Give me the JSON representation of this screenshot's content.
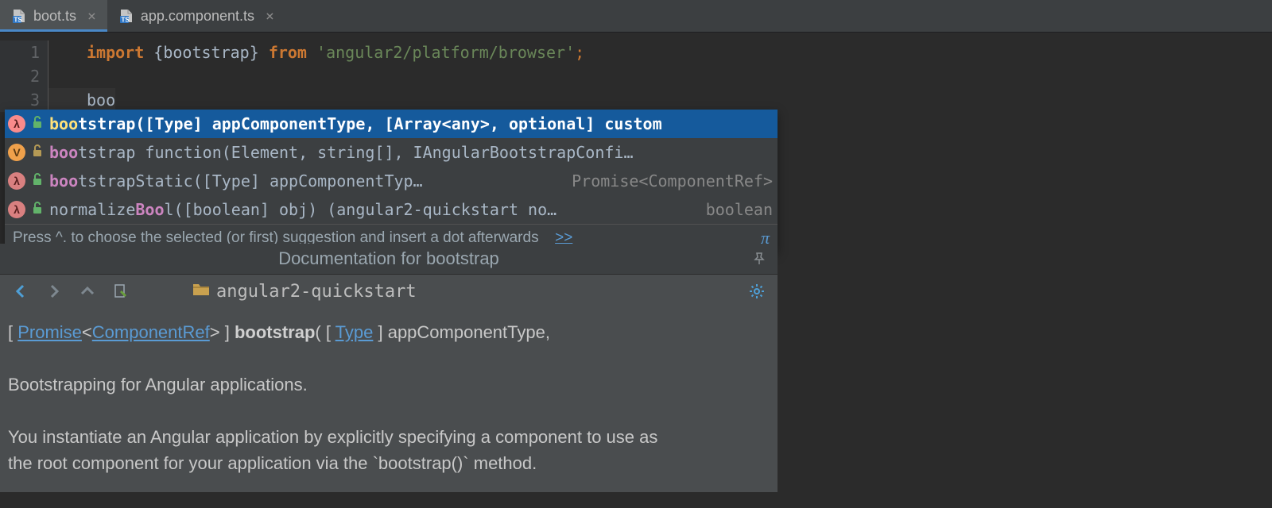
{
  "tabs": [
    {
      "label": "boot.ts",
      "active": true,
      "closeable": true
    },
    {
      "label": "app.component.ts",
      "active": false,
      "closeable": true
    }
  ],
  "code": {
    "line1": {
      "kw_import": "import ",
      "brace_open": "{",
      "ident": "bootstrap",
      "brace_close": "} ",
      "kw_from": "from ",
      "str": "'angular2/platform/browser'",
      "semi": ";"
    },
    "line2": "",
    "line3": "boo"
  },
  "gutter": [
    "1",
    "2",
    "3"
  ],
  "completion": {
    "items": [
      {
        "badge": "λ",
        "badgeClass": "lambda",
        "lock": true,
        "lockDim": false,
        "match": "boo",
        "rest": "tstrap([Type] appComponentType, [Array<any>, optional] custom",
        "ret": "",
        "selected": true
      },
      {
        "badge": "V",
        "badgeClass": "v",
        "lock": true,
        "lockDim": true,
        "match": "boo",
        "rest": "tstrap   function(Element, string[], IAngularBootstrapConfi…",
        "ret": "",
        "selected": false
      },
      {
        "badge": "λ",
        "badgeClass": "lambda-dim",
        "lock": true,
        "lockDim": false,
        "match": "boo",
        "rest": "tstrapStatic([Type] appComponentTyp…",
        "ret": "Promise<ComponentRef>",
        "selected": false
      },
      {
        "badge": "λ",
        "badgeClass": "lambda-dim",
        "lock": true,
        "lockDim": false,
        "match_pre": "normalize",
        "match": "Boo",
        "rest": "l([boolean] obj) (angular2-quickstart no…",
        "ret": "boolean",
        "selected": false
      }
    ],
    "footer_hint": "Press ^. to choose the selected (or first) suggestion and insert a dot afterwards",
    "footer_link": ">>",
    "footer_pi": "π"
  },
  "documentation": {
    "title": "Documentation for bootstrap",
    "path": "angular2-quickstart",
    "signature_open": "[ ",
    "sig_link1": "Promise",
    "sig_lt": "<",
    "sig_link2": "ComponentRef",
    "sig_gt_close": "> ] ",
    "sig_bold": "bootstrap",
    "sig_after_bold": "( [ ",
    "sig_link3": "Type",
    "sig_after_type": " ] appComponentType,",
    "paragraph1": "Bootstrapping for Angular applications.",
    "paragraph2": "You instantiate an Angular application by explicitly specifying a component to use as the root component for your application via the `bootstrap()` method."
  }
}
